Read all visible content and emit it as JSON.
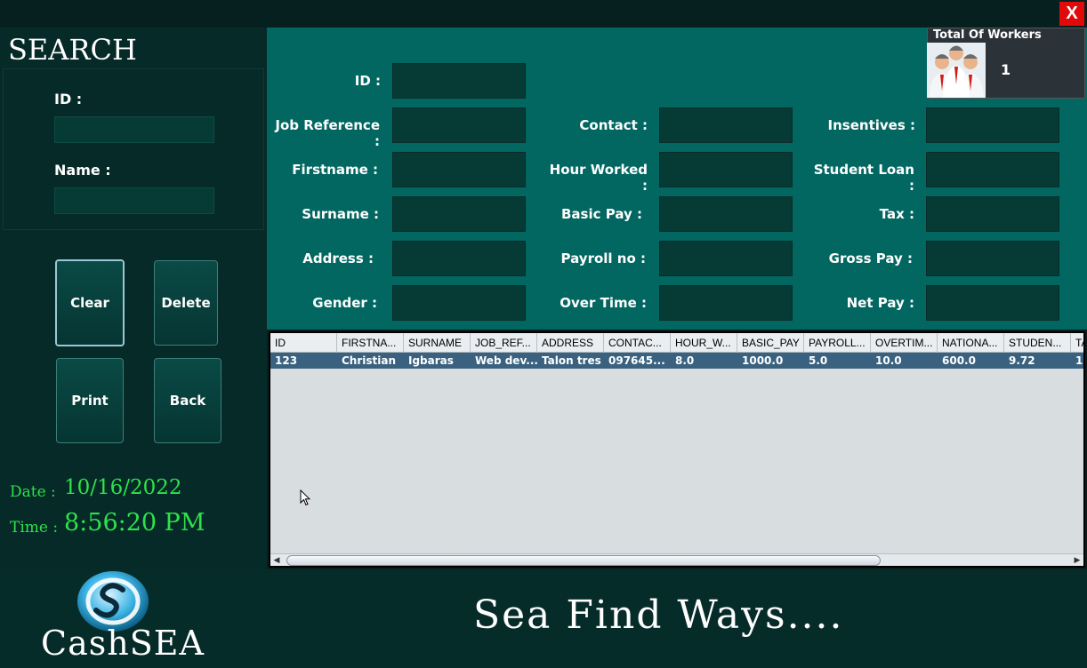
{
  "window": {
    "close_label": "X"
  },
  "search": {
    "title": "SEARCH",
    "id_label": "ID :",
    "name_label": "Name :"
  },
  "buttons": {
    "clear": "Clear",
    "delete": "Delete",
    "print": "Print",
    "back": "Back"
  },
  "datetime": {
    "date_label": "Date :",
    "date_value": "10/16/2022",
    "time_label": "Time :",
    "time_value": "8:56:20 PM"
  },
  "form": {
    "id": "ID :",
    "job_reference": "Job Reference :",
    "firstname": "Firstname :",
    "surname": "Surname :",
    "address": "Address :",
    "gender": "Gender :",
    "contact": "Contact :",
    "hour_worked": "Hour Worked :",
    "basic_pay": "Basic Pay :",
    "payroll_no": "Payroll no :",
    "over_time": "Over Time :",
    "insentives": "Insentives :",
    "student_loan": "Student Loan :",
    "tax": "Tax :",
    "gross_pay": "Gross Pay :",
    "net_pay": "Net Pay :"
  },
  "workers": {
    "title": "Total Of Workers",
    "count": "1",
    "icon": "people-group-icon"
  },
  "table": {
    "columns": [
      "ID",
      "FIRSTNA...",
      "SURNAME",
      "JOB_REF...",
      "ADDRESS",
      "CONTAC...",
      "HOUR_W...",
      "BASIC_PAY",
      "PAYROLL...",
      "OVERTIM...",
      "NATIONA...",
      "STUDEN...",
      "TA"
    ],
    "rows": [
      [
        "123",
        "Christian",
        "Igbaras",
        "Web dev...",
        "Talon tres",
        "097645...",
        "8.0",
        "1000.0",
        "5.0",
        "10.0",
        "600.0",
        "9.72",
        "1"
      ]
    ]
  },
  "footer": {
    "brand": "CashSEA",
    "tagline": "Sea Find Ways...."
  },
  "colors": {
    "form_bg": "#026661",
    "panel_bg": "#062a28",
    "close": "#e00a0a",
    "clock": "#2ee24a",
    "selected_row": "#3a6280"
  }
}
